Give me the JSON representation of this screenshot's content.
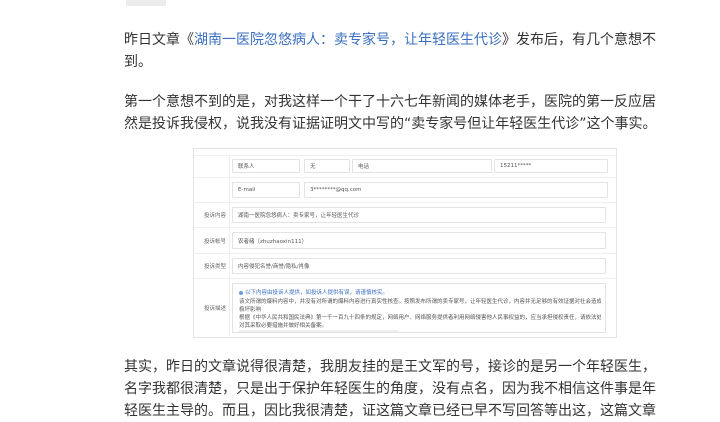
{
  "article": {
    "p1_before": "昨日文章《",
    "p1_link": "湖南一医院忽悠病人：卖专家号，让年轻医生代诊",
    "p1_after": "》发布后，有几个意想不到。",
    "p2": "第一个意想不到的是，对我这样一个干了十六七年新闻的媒体老手，医院的第一反应居然是投诉我侵权，说我没有证据证明文中写的“卖专家号但让年轻医生代诊”这个事实。",
    "p3": "其实，昨日的文章说得很清楚，我朋友挂的是王文军的号，接诊的是另一个年轻医生，名字我都很清楚，只是出于保护年轻医生的角度，没有点名，因为我不相信这件事是年轻医生主导的。而且，因比我很清楚，证这篇文章已经已早不写回答等出这，这篇文章"
  },
  "complaint_form": {
    "contact": {
      "label": "联系人",
      "value": "无",
      "phone_label": "电话",
      "phone_value": "15211*****"
    },
    "email": {
      "label": "E-mail",
      "value": "3********@qq.com"
    },
    "title": {
      "label": "投诉内容",
      "value": "湖南一医院忽悠病人：卖专家号，让年轻医生代诊"
    },
    "account": {
      "label": "投诉帐号",
      "value": "农者绪（zhuzhaoxin111）"
    },
    "type": {
      "label": "投诉类型",
      "value": "内容侵犯名誉/商誉/隐私/肖像"
    },
    "description": {
      "label": "投诉描述",
      "hint": "以下内容由投诉人提供，如投诉人提供有误，请谨慎核实。",
      "lines": [
        "该文所谓的爆料内容中，并没有对所谓的爆料内容进行真实性核查。按照发布所谓的卖专家号，让年轻医生代诊，内容并无足够的有效证据对社会造成",
        "极坏影响",
        "根据《中华人民共和国民法典》第一千一百九十四条的规定，网络用户、网络服务提供者利用网络侵害他人民事权益的，应当承担侵权责任，请依法处理",
        "对其采取必要措施并做好相关备案。"
      ]
    }
  }
}
